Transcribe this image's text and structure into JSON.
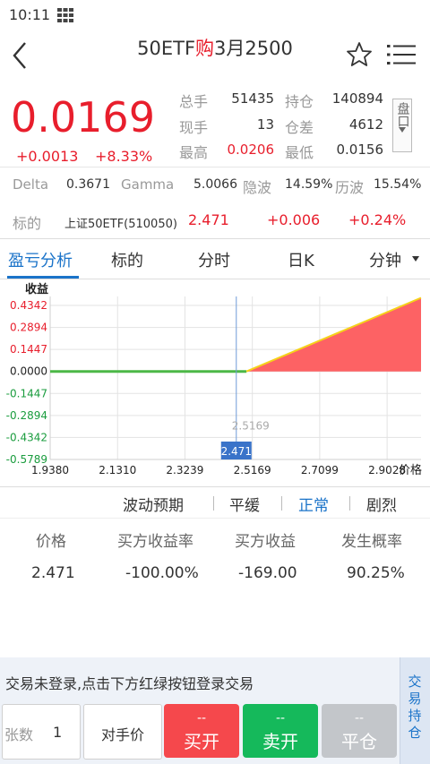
{
  "status": {
    "time": "10:11"
  },
  "header": {
    "title_prefix": "50ETF",
    "title_mid": "购",
    "title_suffix": "3月2500"
  },
  "quote": {
    "price": "0.0169",
    "change": "+0.0013",
    "change_pct": "+8.33%",
    "stats": [
      {
        "label": "总手",
        "value": "51435",
        "label2": "持仓",
        "value2": "140894"
      },
      {
        "label": "现手",
        "value": "13",
        "label2": "仓差",
        "value2": "4612"
      },
      {
        "label": "最高",
        "value": "0.0206",
        "label2": "最低",
        "value2": "0.0156"
      }
    ],
    "pan_button": "盘口"
  },
  "greeks": {
    "delta_label": "Delta",
    "delta": "0.3671",
    "gamma_label": "Gamma",
    "gamma": "5.0066",
    "iv_label": "隐波",
    "iv": "14.59%",
    "hv_label": "历波",
    "hv": "15.54%"
  },
  "underlying": {
    "label": "标的",
    "name": "上证50ETF(510050)",
    "price": "2.471",
    "change": "+0.006",
    "change_pct": "+0.24%"
  },
  "tabs": [
    "盈亏分析",
    "标的",
    "分时",
    "日K",
    "分钟"
  ],
  "chart_data": {
    "type": "area",
    "ylabel": "收益",
    "xlabel": "价格",
    "x_ticks": [
      "1.9380",
      "2.1310",
      "2.3239",
      "2.5169",
      "2.7099",
      "2.9028"
    ],
    "y_ticks": [
      "0.4342",
      "0.2894",
      "0.1447",
      "0.0000",
      "-0.1447",
      "-0.2894",
      "-0.4342",
      "-0.5789"
    ],
    "ylim": [
      -0.5789,
      0.4342
    ],
    "xlim": [
      1.938,
      3.0
    ],
    "series": [
      {
        "values_x": [
          1.938,
          2.5,
          3.0
        ],
        "values_y": [
          0.0,
          0.0,
          0.4842
        ]
      }
    ],
    "current_price": "2.471",
    "strike_label": "2.5169",
    "colors": {
      "profit_fill": "#fd6264",
      "profit_line": "#f5d21a",
      "flat_line": "#4cb847",
      "cursor": "#6f9bd8",
      "tag_bg": "#3a73c9"
    }
  },
  "scenario": {
    "label": "波动预期",
    "options": [
      "平缓",
      "正常",
      "剧烈"
    ],
    "active": "正常"
  },
  "table": {
    "headers": [
      "价格",
      "买方收益率",
      "买方收益",
      "发生概率"
    ],
    "row": [
      "2.471",
      "-100.00%",
      "-169.00",
      "90.25%"
    ]
  },
  "trade": {
    "login_msg": "交易未登录,点击下方红绿按钮登录交易",
    "qty_label": "张数",
    "qty_value": "1",
    "counter_price": "对手价",
    "buy_open": "买开",
    "sell_open": "卖开",
    "close": "平仓",
    "dash": "--",
    "side_tab": "交易持仓"
  }
}
